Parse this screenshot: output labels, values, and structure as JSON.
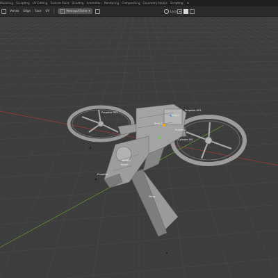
{
  "workspace_tabs": [
    {
      "label": "Modeling",
      "active": false
    },
    {
      "label": "Sculpting",
      "active": false
    },
    {
      "label": "UV Editing",
      "active": false
    },
    {
      "label": "Texture Paint",
      "active": false
    },
    {
      "label": "Shading",
      "active": false
    },
    {
      "label": "Animation",
      "active": false
    },
    {
      "label": "Rendering",
      "active": false
    },
    {
      "label": "Compositing",
      "active": false
    },
    {
      "label": "Geometry Nodes",
      "active": false
    },
    {
      "label": "Scripting",
      "active": false
    }
  ],
  "add_tab_label": "+",
  "toolbar": {
    "mode_items": [
      "Vertex",
      "Edge",
      "Face",
      "UV"
    ],
    "material_label": "MetropoFlame",
    "orientation_label": "Local"
  },
  "object_labels": [
    "Propeller.002",
    "Body.1",
    "Body.2",
    "Propeller.001",
    "Engine.1",
    "Cylinder.001",
    "Empty",
    "Beam",
    "Propeller",
    "Wing"
  ],
  "colors": {
    "viewport_bg": "#3d3d3d",
    "grid": "#4a4a4a",
    "x_axis": "#8a3a3a",
    "y_axis": "#5f8a2e",
    "mesh": "#8f8f8f"
  }
}
